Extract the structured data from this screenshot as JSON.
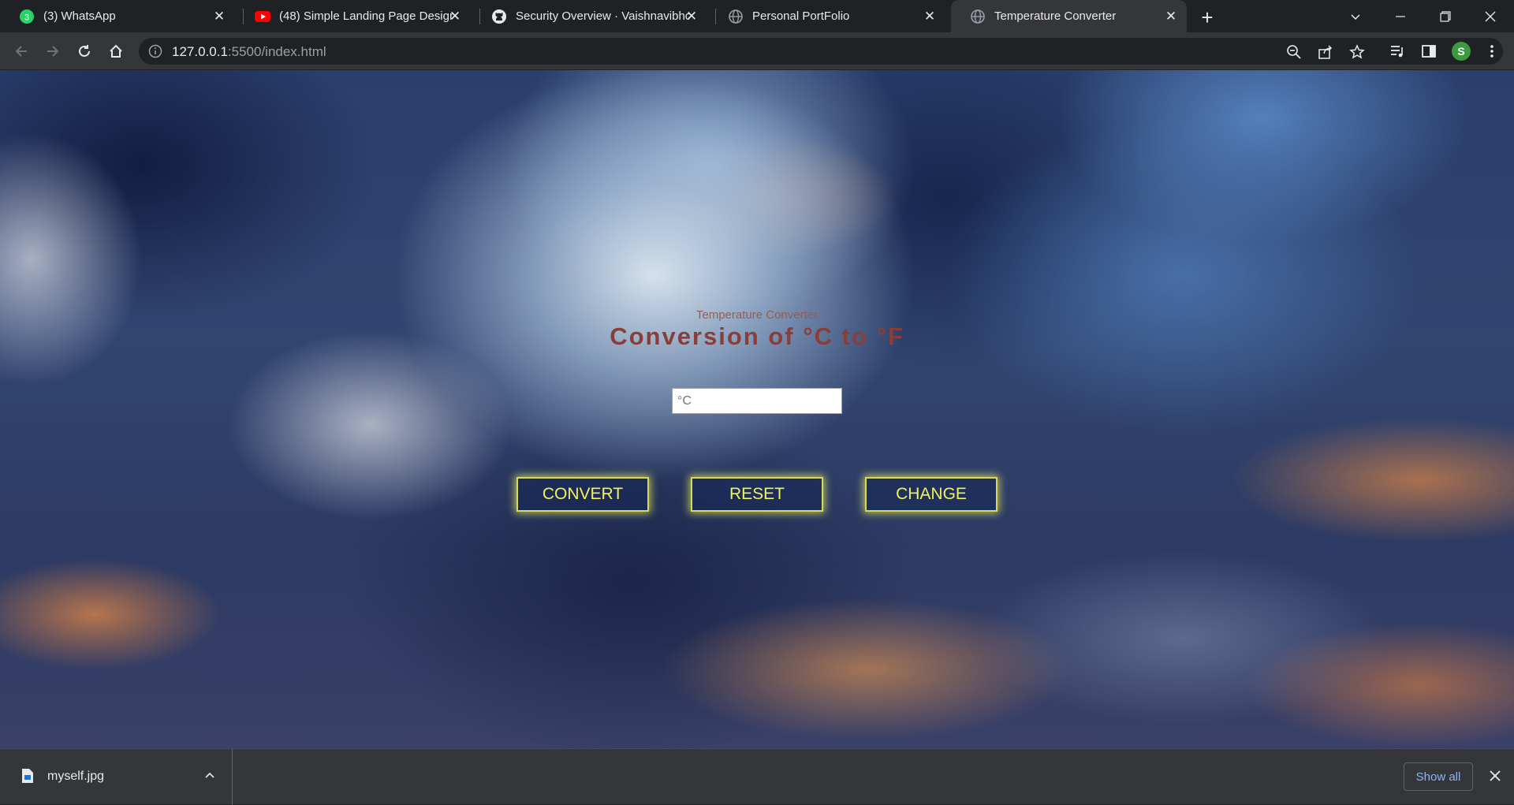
{
  "browser": {
    "tabs": [
      {
        "title": "(3) WhatsApp",
        "favicon": "whatsapp-icon",
        "badge": "3"
      },
      {
        "title": "(48) Simple Landing Page Design",
        "favicon": "youtube-icon"
      },
      {
        "title": "Security Overview · Vaishnavibho",
        "favicon": "github-icon"
      },
      {
        "title": "Personal PortFolio",
        "favicon": "globe-icon"
      },
      {
        "title": "Temperature Converter",
        "favicon": "globe-icon",
        "active": true
      }
    ],
    "address": {
      "host": "127.0.0.1",
      "rest": ":5500/index.html"
    },
    "profile_initial": "S"
  },
  "page": {
    "subtitle": "Temperature Converter",
    "heading": "Conversion of °C to °F",
    "input_placeholder": "°C",
    "buttons": {
      "convert": "CONVERT",
      "reset": "RESET",
      "change": "CHANGE"
    },
    "colors": {
      "heading": "#8a3e3a",
      "button_text": "#f2f25a",
      "button_glow": "#e6eb5a"
    }
  },
  "downloads": {
    "file_name": "myself.jpg",
    "show_all": "Show all"
  }
}
